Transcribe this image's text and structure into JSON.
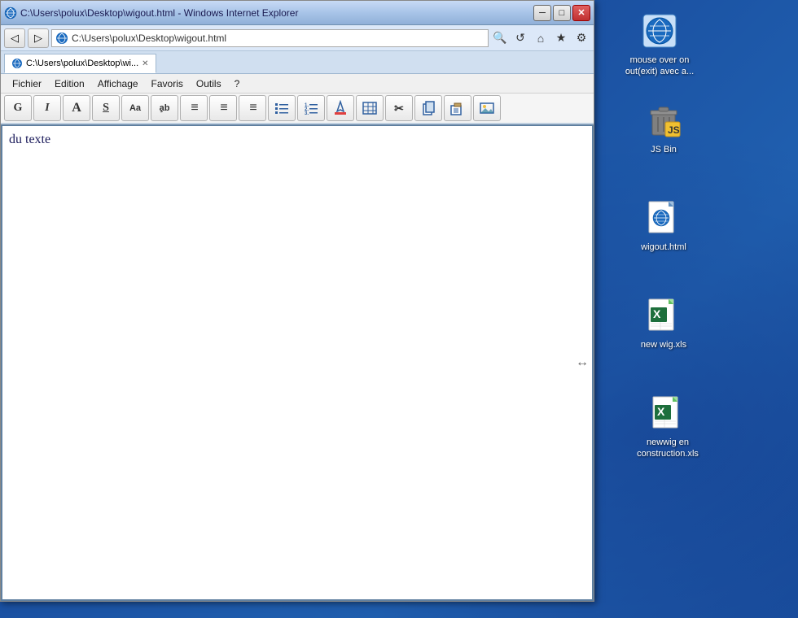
{
  "browser": {
    "title": "C:\\Users\\polux\\Desktop\\wigout.html - Windows Internet Explorer",
    "address": "C:\\Users\\polux\\Desktop\\wigout.html",
    "tab_label": "C:\\Users\\polux\\Desktop\\wi...",
    "minimize_label": "─",
    "maximize_label": "□",
    "close_label": "✕"
  },
  "menu": {
    "items": [
      "Fichier",
      "Edition",
      "Affichage",
      "Favoris",
      "Outils",
      "?"
    ]
  },
  "toolbar": {
    "buttons": [
      {
        "label": "G",
        "title": "Gras"
      },
      {
        "label": "I",
        "title": "Italique"
      },
      {
        "label": "A",
        "title": "Police"
      },
      {
        "label": "S",
        "title": "Souligner"
      },
      {
        "label": "Aa",
        "title": "Taille"
      },
      {
        "label": "a̧b",
        "title": "Format"
      },
      {
        "label": "≡",
        "title": "Aligner gauche"
      },
      {
        "label": "≡",
        "title": "Centrer"
      },
      {
        "label": "≡",
        "title": "Aligner droite"
      },
      {
        "label": "☰",
        "title": "Liste"
      },
      {
        "label": "☷",
        "title": "Liste num"
      },
      {
        "label": "◈",
        "title": "Couleur"
      },
      {
        "label": "⊞",
        "title": "Tableau"
      },
      {
        "label": "✂",
        "title": "Couper"
      },
      {
        "label": "⊡",
        "title": "Copier"
      },
      {
        "label": "⊟",
        "title": "Coller"
      },
      {
        "label": "⊠",
        "title": "Image"
      }
    ]
  },
  "content": {
    "text": "du texte"
  },
  "desktop": {
    "icons": [
      {
        "id": "mouse-over",
        "label": "mouse over on out(exit) avec a...",
        "type": "ie"
      },
      {
        "id": "js-bin",
        "label": "JS Bin",
        "type": "trash"
      },
      {
        "id": "wigout",
        "label": "wigout.html",
        "type": "ie"
      },
      {
        "id": "new-wig",
        "label": "new wig.xls",
        "type": "excel"
      },
      {
        "id": "newwig-construction",
        "label": "newwig en construction.xls",
        "type": "excel"
      }
    ]
  }
}
